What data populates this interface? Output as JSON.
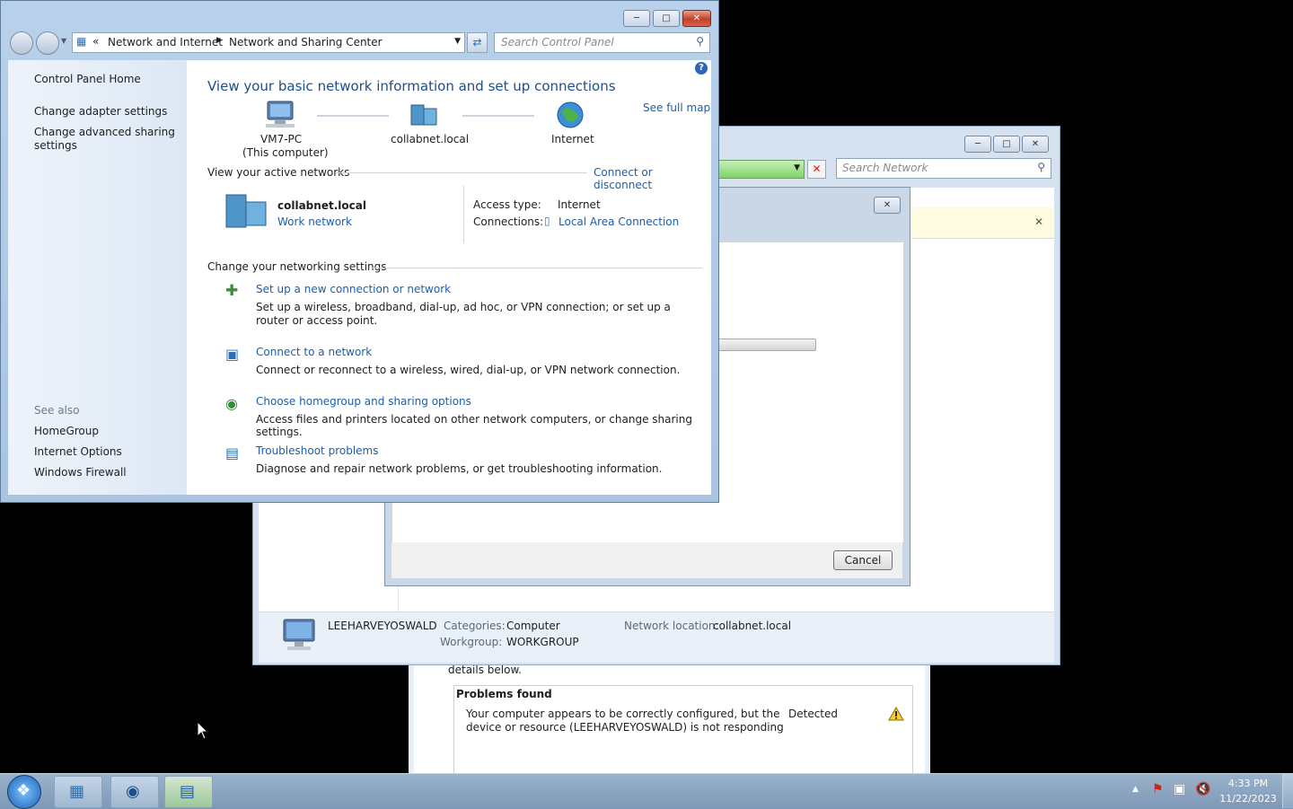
{
  "control_panel": {
    "breadcrumb": [
      "Network and Internet",
      "Network and Sharing Center"
    ],
    "search_placeholder": "Search Control Panel",
    "left_nav": {
      "home": "Control Panel Home",
      "adapter": "Change adapter settings",
      "advanced_1": "Change advanced sharing",
      "advanced_2": "settings",
      "see_also": "See also",
      "homegroup": "HomeGroup",
      "internet_options": "Internet Options",
      "firewall": "Windows Firewall"
    },
    "heading": "View your basic network information and set up connections",
    "see_full_map": "See full map",
    "map": {
      "computer_name": "VM7-PC",
      "computer_sub": "(This computer)",
      "domain": "collabnet.local",
      "internet": "Internet"
    },
    "active_networks_label": "View your active networks",
    "connect_disconnect": "Connect or disconnect",
    "network": {
      "name": "collabnet.local",
      "type": "Work network",
      "access_label": "Access type:",
      "access_value": "Internet",
      "connections_label": "Connections:",
      "connections_value": "Local Area Connection"
    },
    "settings_label": "Change your networking settings",
    "tasks": [
      {
        "title": "Set up a new connection or network",
        "desc": "Set up a wireless, broadband, dial-up, ad hoc, or VPN connection; or set up a router or access point."
      },
      {
        "title": "Connect to a network",
        "desc": "Connect or reconnect to a wireless, wired, dial-up, or VPN network connection."
      },
      {
        "title": "Choose homegroup and sharing options",
        "desc": "Access files and printers located on other network computers, or change sharing settings."
      },
      {
        "title": "Troubleshoot problems",
        "desc": "Diagnose and repair network problems, or get troubleshooting information."
      }
    ]
  },
  "network_window": {
    "search_placeholder": "Search Network",
    "details": {
      "name": "LEEHARVEYOSWALD",
      "categories_label": "Categories:",
      "categories_value": "Computer",
      "workgroup_label": "Workgroup:",
      "workgroup_value": "WORKGROUP",
      "location_label": "Network location:",
      "location_value": "collabnet.local"
    }
  },
  "dialog": {
    "cancel": "Cancel"
  },
  "troubleshooter": {
    "details_text": "details below.",
    "problems_found": "Problems found",
    "problem_line1": "Your computer appears to be correctly configured, but the",
    "problem_line2": "device or resource (LEEHARVEYOSWALD) is not responding",
    "status": "Detected"
  },
  "taskbar": {
    "time": "4:33 PM",
    "date": "11/22/2023"
  },
  "colors": {
    "link": "#1e5ea8",
    "heading": "#1e4e8c",
    "window_frame": "#a9c4e0"
  }
}
